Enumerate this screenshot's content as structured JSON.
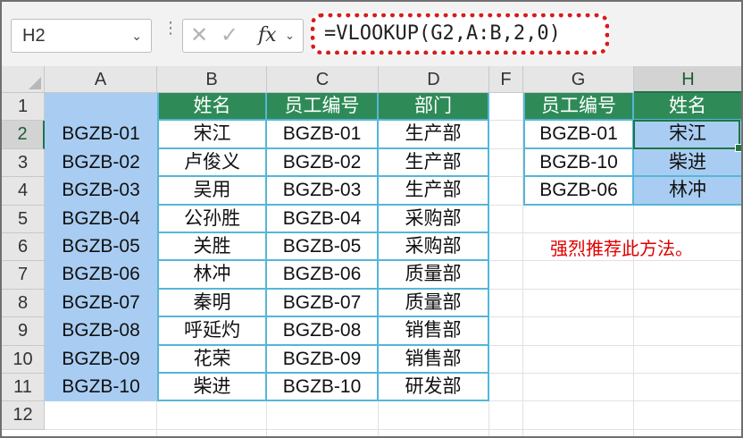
{
  "name_box": {
    "value": "H2",
    "dropdown_icon": "chevron-down-icon"
  },
  "formula_controls": {
    "cancel_icon": "close-icon",
    "enter_icon": "check-icon",
    "function_label": "fx",
    "function_icon": "function-icon"
  },
  "formula": {
    "text": "=VLOOKUP(G2,A:B,2,0)"
  },
  "columns": [
    "A",
    "B",
    "C",
    "D",
    "F",
    "G",
    "H"
  ],
  "rows": [
    "1",
    "2",
    "3",
    "4",
    "5",
    "6",
    "7",
    "8",
    "9",
    "10",
    "11",
    "12"
  ],
  "active_cell": "H2",
  "main_table": {
    "headers": [
      "姓名",
      "员工编号",
      "部门"
    ],
    "id_column": [
      "BGZB-01",
      "BGZB-02",
      "BGZB-03",
      "BGZB-04",
      "BGZB-05",
      "BGZB-06",
      "BGZB-07",
      "BGZB-08",
      "BGZB-09",
      "BGZB-10"
    ],
    "rows": [
      [
        "宋江",
        "BGZB-01",
        "生产部"
      ],
      [
        "卢俊义",
        "BGZB-02",
        "生产部"
      ],
      [
        "吴用",
        "BGZB-03",
        "生产部"
      ],
      [
        "公孙胜",
        "BGZB-04",
        "采购部"
      ],
      [
        "关胜",
        "BGZB-05",
        "采购部"
      ],
      [
        "林冲",
        "BGZB-06",
        "质量部"
      ],
      [
        "秦明",
        "BGZB-07",
        "质量部"
      ],
      [
        "呼延灼",
        "BGZB-08",
        "销售部"
      ],
      [
        "花荣",
        "BGZB-09",
        "销售部"
      ],
      [
        "柴进",
        "BGZB-10",
        "研发部"
      ]
    ]
  },
  "lookup_table": {
    "headers": [
      "员工编号",
      "姓名"
    ],
    "rows": [
      [
        "BGZB-01",
        "宋江"
      ],
      [
        "BGZB-10",
        "柴进"
      ],
      [
        "BGZB-06",
        "林冲"
      ]
    ]
  },
  "note": "强烈推荐此方法。",
  "colors": {
    "header_green": "#2e8b57",
    "table_border": "#55b6d8",
    "highlight_blue": "#a9cdf2",
    "formula_border": "#d81b1b",
    "note_red": "#e00000"
  }
}
